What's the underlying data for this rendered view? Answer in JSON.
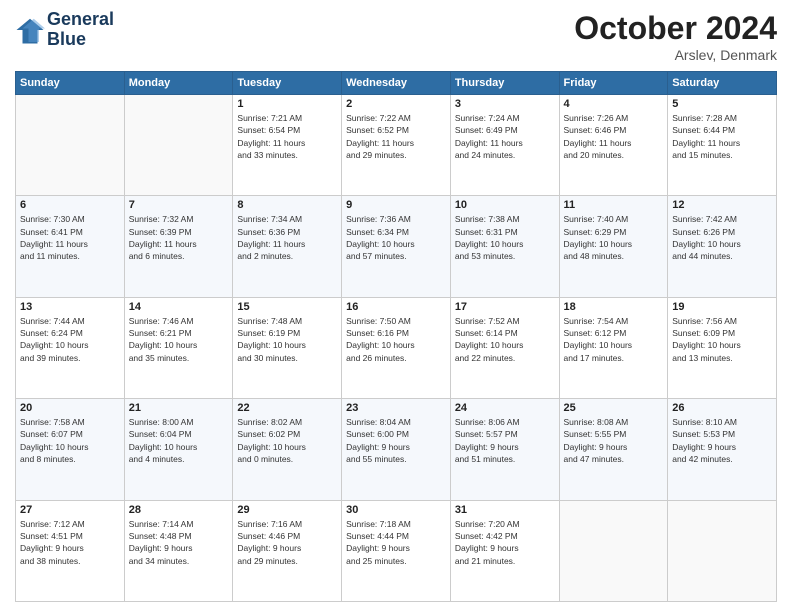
{
  "logo": {
    "line1": "General",
    "line2": "Blue"
  },
  "title": "October 2024",
  "subtitle": "Arslev, Denmark",
  "days_header": [
    "Sunday",
    "Monday",
    "Tuesday",
    "Wednesday",
    "Thursday",
    "Friday",
    "Saturday"
  ],
  "weeks": [
    [
      {
        "day": "",
        "info": ""
      },
      {
        "day": "",
        "info": ""
      },
      {
        "day": "1",
        "info": "Sunrise: 7:21 AM\nSunset: 6:54 PM\nDaylight: 11 hours\nand 33 minutes."
      },
      {
        "day": "2",
        "info": "Sunrise: 7:22 AM\nSunset: 6:52 PM\nDaylight: 11 hours\nand 29 minutes."
      },
      {
        "day": "3",
        "info": "Sunrise: 7:24 AM\nSunset: 6:49 PM\nDaylight: 11 hours\nand 24 minutes."
      },
      {
        "day": "4",
        "info": "Sunrise: 7:26 AM\nSunset: 6:46 PM\nDaylight: 11 hours\nand 20 minutes."
      },
      {
        "day": "5",
        "info": "Sunrise: 7:28 AM\nSunset: 6:44 PM\nDaylight: 11 hours\nand 15 minutes."
      }
    ],
    [
      {
        "day": "6",
        "info": "Sunrise: 7:30 AM\nSunset: 6:41 PM\nDaylight: 11 hours\nand 11 minutes."
      },
      {
        "day": "7",
        "info": "Sunrise: 7:32 AM\nSunset: 6:39 PM\nDaylight: 11 hours\nand 6 minutes."
      },
      {
        "day": "8",
        "info": "Sunrise: 7:34 AM\nSunset: 6:36 PM\nDaylight: 11 hours\nand 2 minutes."
      },
      {
        "day": "9",
        "info": "Sunrise: 7:36 AM\nSunset: 6:34 PM\nDaylight: 10 hours\nand 57 minutes."
      },
      {
        "day": "10",
        "info": "Sunrise: 7:38 AM\nSunset: 6:31 PM\nDaylight: 10 hours\nand 53 minutes."
      },
      {
        "day": "11",
        "info": "Sunrise: 7:40 AM\nSunset: 6:29 PM\nDaylight: 10 hours\nand 48 minutes."
      },
      {
        "day": "12",
        "info": "Sunrise: 7:42 AM\nSunset: 6:26 PM\nDaylight: 10 hours\nand 44 minutes."
      }
    ],
    [
      {
        "day": "13",
        "info": "Sunrise: 7:44 AM\nSunset: 6:24 PM\nDaylight: 10 hours\nand 39 minutes."
      },
      {
        "day": "14",
        "info": "Sunrise: 7:46 AM\nSunset: 6:21 PM\nDaylight: 10 hours\nand 35 minutes."
      },
      {
        "day": "15",
        "info": "Sunrise: 7:48 AM\nSunset: 6:19 PM\nDaylight: 10 hours\nand 30 minutes."
      },
      {
        "day": "16",
        "info": "Sunrise: 7:50 AM\nSunset: 6:16 PM\nDaylight: 10 hours\nand 26 minutes."
      },
      {
        "day": "17",
        "info": "Sunrise: 7:52 AM\nSunset: 6:14 PM\nDaylight: 10 hours\nand 22 minutes."
      },
      {
        "day": "18",
        "info": "Sunrise: 7:54 AM\nSunset: 6:12 PM\nDaylight: 10 hours\nand 17 minutes."
      },
      {
        "day": "19",
        "info": "Sunrise: 7:56 AM\nSunset: 6:09 PM\nDaylight: 10 hours\nand 13 minutes."
      }
    ],
    [
      {
        "day": "20",
        "info": "Sunrise: 7:58 AM\nSunset: 6:07 PM\nDaylight: 10 hours\nand 8 minutes."
      },
      {
        "day": "21",
        "info": "Sunrise: 8:00 AM\nSunset: 6:04 PM\nDaylight: 10 hours\nand 4 minutes."
      },
      {
        "day": "22",
        "info": "Sunrise: 8:02 AM\nSunset: 6:02 PM\nDaylight: 10 hours\nand 0 minutes."
      },
      {
        "day": "23",
        "info": "Sunrise: 8:04 AM\nSunset: 6:00 PM\nDaylight: 9 hours\nand 55 minutes."
      },
      {
        "day": "24",
        "info": "Sunrise: 8:06 AM\nSunset: 5:57 PM\nDaylight: 9 hours\nand 51 minutes."
      },
      {
        "day": "25",
        "info": "Sunrise: 8:08 AM\nSunset: 5:55 PM\nDaylight: 9 hours\nand 47 minutes."
      },
      {
        "day": "26",
        "info": "Sunrise: 8:10 AM\nSunset: 5:53 PM\nDaylight: 9 hours\nand 42 minutes."
      }
    ],
    [
      {
        "day": "27",
        "info": "Sunrise: 7:12 AM\nSunset: 4:51 PM\nDaylight: 9 hours\nand 38 minutes."
      },
      {
        "day": "28",
        "info": "Sunrise: 7:14 AM\nSunset: 4:48 PM\nDaylight: 9 hours\nand 34 minutes."
      },
      {
        "day": "29",
        "info": "Sunrise: 7:16 AM\nSunset: 4:46 PM\nDaylight: 9 hours\nand 29 minutes."
      },
      {
        "day": "30",
        "info": "Sunrise: 7:18 AM\nSunset: 4:44 PM\nDaylight: 9 hours\nand 25 minutes."
      },
      {
        "day": "31",
        "info": "Sunrise: 7:20 AM\nSunset: 4:42 PM\nDaylight: 9 hours\nand 21 minutes."
      },
      {
        "day": "",
        "info": ""
      },
      {
        "day": "",
        "info": ""
      }
    ]
  ]
}
